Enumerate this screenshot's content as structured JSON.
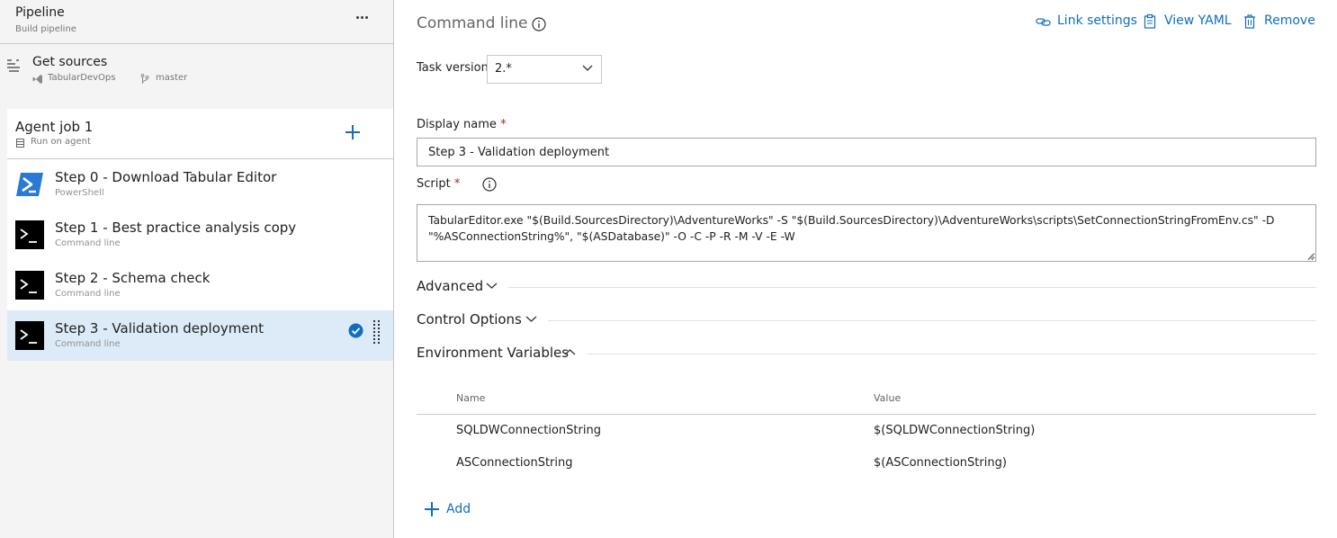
{
  "pipeline": {
    "title": "Pipeline",
    "subtitle": "Build pipeline"
  },
  "get_sources": {
    "title": "Get sources",
    "repo": "TabularDevOps",
    "branch": "master"
  },
  "agent_job": {
    "title": "Agent job 1",
    "subtitle": "Run on agent"
  },
  "tasks": [
    {
      "name": "Step 0 - Download Tabular Editor",
      "type": "PowerShell",
      "icon": "powershell-icon",
      "selected": false
    },
    {
      "name": "Step 1 - Best practice analysis copy",
      "type": "Command line",
      "icon": "command-line-icon",
      "selected": false
    },
    {
      "name": "Step 2 - Schema check",
      "type": "Command line",
      "icon": "command-line-icon",
      "selected": false
    },
    {
      "name": "Step 3 - Validation deployment",
      "type": "Command line",
      "icon": "command-line-icon",
      "selected": true
    }
  ],
  "detail": {
    "title": "Command line",
    "actions": {
      "link_settings": "Link settings",
      "view_yaml": "View YAML",
      "remove": "Remove"
    },
    "task_version": {
      "label": "Task version",
      "value": "2.*"
    },
    "display_name": {
      "label": "Display name",
      "required_mark": "*",
      "value": "Step 3 - Validation deployment"
    },
    "script": {
      "label": "Script",
      "required_mark": "*",
      "line1": "TabularEditor.exe \"$(Build.SourcesDirectory)\\AdventureWorks\" -S \"$(Build.SourcesDirectory)\\AdventureWorks\\scripts\\SetConnectionStringFromEnv.cs\" -D",
      "line2": "\"%ASConnectionString%\", \"$(ASDatabase)\" -O -C -P -R -M -V -E -W"
    },
    "sections": {
      "advanced": "Advanced",
      "control_options": "Control Options",
      "environment_variables": "Environment Variables"
    },
    "env_table": {
      "headers": {
        "name": "Name",
        "value": "Value"
      },
      "rows": [
        {
          "name": "SQLDWConnectionString",
          "value": "$(SQLDWConnectionString)"
        },
        {
          "name": "ASConnectionString",
          "value": "$(ASConnectionString)"
        }
      ]
    },
    "add_label": "Add"
  },
  "colors": {
    "accent": "#106ebe",
    "selected_row": "#dcebf7",
    "required": "#a4262c",
    "panel_bg": "#f4f4f4"
  }
}
